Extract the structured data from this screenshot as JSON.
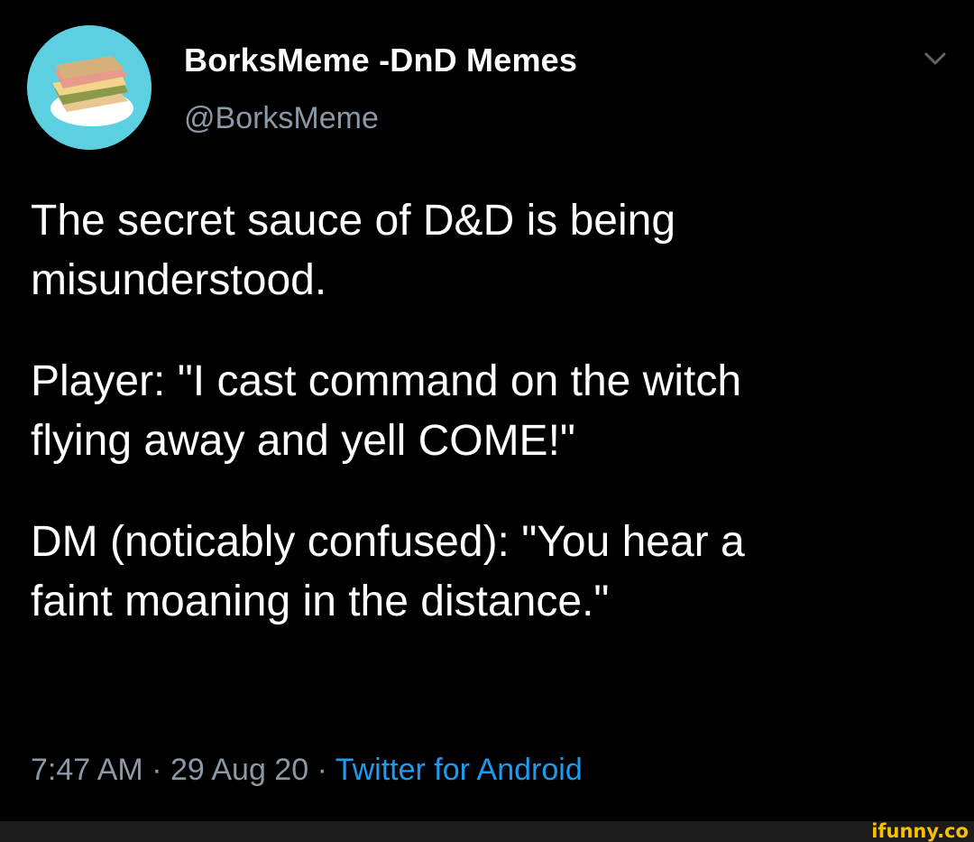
{
  "tweet": {
    "display_name": "BorksMeme -DnD Memes",
    "handle": "@BorksMeme",
    "avatar_icon": "sandwich-avatar-icon",
    "menu_icon": "chevron-down-icon",
    "paragraphs": [
      "The secret sauce of D&D is being\nmisunderstood.",
      "Player: \"I cast command on the witch\nflying away and yell COME!\"",
      "DM (noticably confused): \"You hear a\nfaint moaning in the distance.\""
    ],
    "time": "7:47 AM",
    "date": "29 Aug 20",
    "separator": " · ",
    "source": "Twitter for Android"
  },
  "footer": {
    "watermark": "ifunny.co"
  },
  "colors": {
    "background": "#000000",
    "text": "#ffffff",
    "muted": "#8b98a5",
    "link": "#1d9bf0",
    "avatar_bg": "#5ccfe0",
    "watermark": "#f9c000"
  }
}
